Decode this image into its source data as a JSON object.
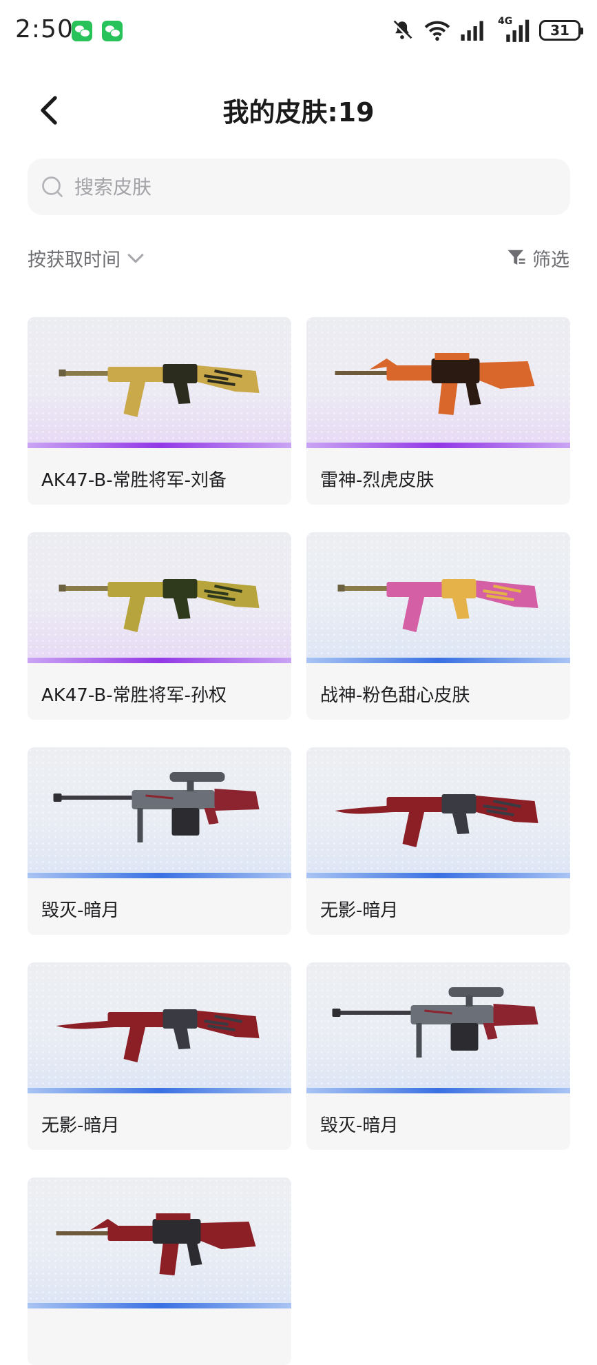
{
  "status_bar": {
    "time": "2:50",
    "battery": "31",
    "network": "4G"
  },
  "header": {
    "title": "我的皮肤:19"
  },
  "search": {
    "placeholder": "搜索皮肤",
    "value": ""
  },
  "toolbar": {
    "sort_label": "按获取时间",
    "filter_label": "筛选"
  },
  "skins": [
    {
      "name": "AK47-B-常胜将军-刘备",
      "rarity": "purple",
      "weapon": "ak-gold-icon",
      "colors": [
        "#c9a94a",
        "#2b2b1e"
      ]
    },
    {
      "name": "雷神-烈虎皮肤",
      "rarity": "purple",
      "weapon": "m4-orange-icon",
      "colors": [
        "#d9662a",
        "#2a1a12"
      ]
    },
    {
      "name": "AK47-B-常胜将军-孙权",
      "rarity": "purple",
      "weapon": "ak-green-gold-icon",
      "colors": [
        "#b8a43c",
        "#2f3a1c"
      ]
    },
    {
      "name": "战神-粉色甜心皮肤",
      "rarity": "blue",
      "weapon": "ak-pink-icon",
      "colors": [
        "#d45fa4",
        "#e5b249"
      ]
    },
    {
      "name": "毁灭-暗月",
      "rarity": "blue",
      "weapon": "sniper-dark-icon",
      "colors": [
        "#6b6f78",
        "#8c2430"
      ]
    },
    {
      "name": "无影-暗月",
      "rarity": "blue",
      "weapon": "ak-blade-dark-icon",
      "colors": [
        "#8c1f26",
        "#3a3a42"
      ]
    },
    {
      "name": "无影-暗月",
      "rarity": "blue",
      "weapon": "ak-blade-dark-icon",
      "colors": [
        "#8c1f26",
        "#3a3a42"
      ]
    },
    {
      "name": "毁灭-暗月",
      "rarity": "blue",
      "weapon": "sniper-dark-icon",
      "colors": [
        "#6b6f78",
        "#8c2430"
      ]
    },
    {
      "name": "",
      "rarity": "blue",
      "weapon": "m4-dark-red-icon",
      "colors": [
        "#8c1f26",
        "#2b2b30"
      ]
    }
  ]
}
